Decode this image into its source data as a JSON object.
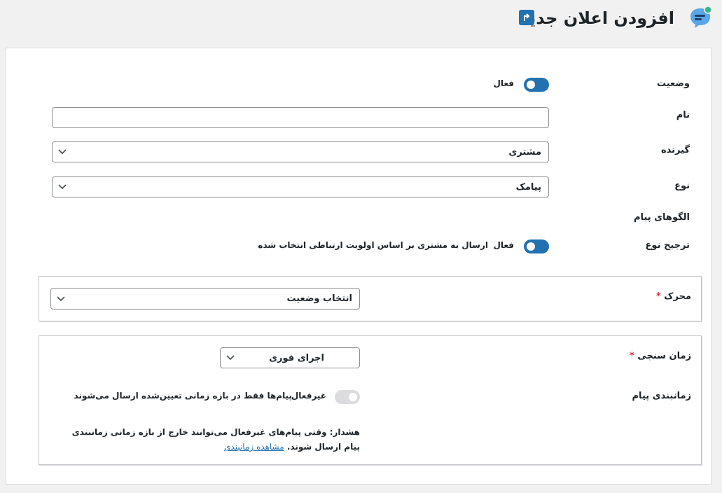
{
  "header": {
    "title": "افزودن اعلان جدید",
    "logo_icon": "chat-bubble-icon",
    "back_icon": "return-arrow-icon",
    "accent_color": "#2271b1"
  },
  "form": {
    "status": {
      "label": "وضعیت",
      "toggle_state": "on",
      "toggle_text": "فعال"
    },
    "name": {
      "label": "نام",
      "value": "",
      "placeholder": ""
    },
    "recipient": {
      "label": "گیرنده",
      "value": "مشتری"
    },
    "type": {
      "label": "نوع",
      "value": "پیامک"
    },
    "message_templates": {
      "label": "الگوهای پیام"
    },
    "type_preference": {
      "label": "ترجیح نوع",
      "toggle_state": "on",
      "toggle_text": "فعال",
      "description": "ارسال به مشتری بر اساس اولویت ارتباطی انتخاب شده"
    }
  },
  "trigger_panel": {
    "label": "محرک",
    "required_mark": "*",
    "select_value": "انتخاب وضعیت"
  },
  "timing_panel": {
    "timing": {
      "label": "زمان سنجی",
      "required_mark": "*",
      "select_value": "اجرای فوری"
    },
    "scheduling": {
      "label": "زمانبندی پیام",
      "toggle_state": "off",
      "toggle_text": "غیرفعال",
      "description": "پیام‌ها فقط در بازه زمانی تعیین‌شده ارسال می‌شوند"
    },
    "warning": {
      "text": "هشدار: وقتی پیام‌های غیرفعال می‌توانند خارج از بازه زمانی زمانبندی پیام ارسال شوند.",
      "link_text": "مشاهده زمانبندی"
    }
  }
}
